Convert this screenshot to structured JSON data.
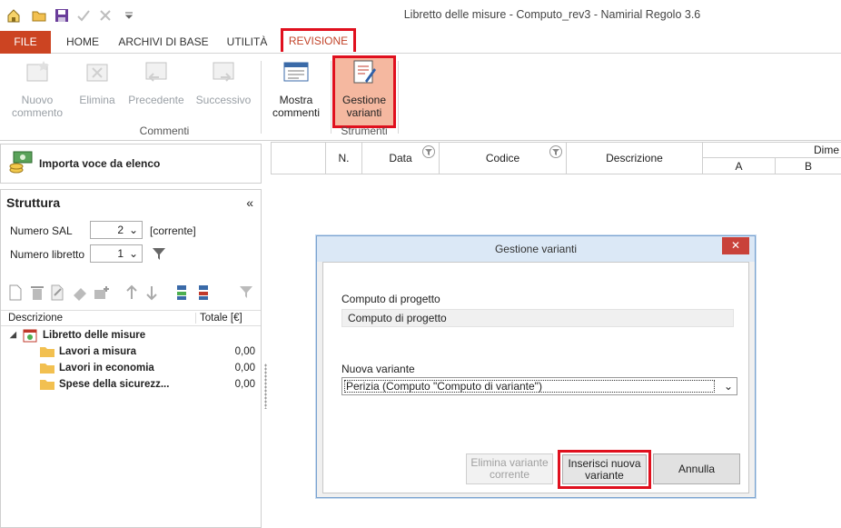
{
  "window": {
    "title": "Libretto delle misure - Computo_rev3 - Namirial Regolo 3.6"
  },
  "menu": {
    "tabs": [
      {
        "label": "FILE"
      },
      {
        "label": "HOME"
      },
      {
        "label": "ARCHIVI DI BASE"
      },
      {
        "label": "UTILITÀ"
      },
      {
        "label": "REVISIONE"
      }
    ]
  },
  "ribbon": {
    "commenti_group": "Commenti",
    "strumenti_group": "Strumenti",
    "nuovo_1": "Nuovo",
    "nuovo_2": "commento",
    "elimina": "Elimina",
    "precedente": "Precedente",
    "successivo": "Successivo",
    "mostra_1": "Mostra",
    "mostra_2": "commenti",
    "gestione_1": "Gestione",
    "gestione_2": "varianti"
  },
  "left": {
    "import_label": "Importa voce da elenco",
    "struttura_title": "Struttura",
    "collapse_glyph": "«",
    "sal_label": "Numero SAL",
    "sal_value": "2",
    "sal_note": "[corrente]",
    "libretto_label": "Numero libretto",
    "libretto_value": "1",
    "col_descrizione": "Descrizione",
    "col_totale": "Totale [€]",
    "tree": {
      "root": "Libretto delle misure",
      "items": [
        {
          "label": "Lavori a misura",
          "value": "0,00"
        },
        {
          "label": "Lavori in economia",
          "value": "0,00"
        },
        {
          "label": "Spese della sicurezz...",
          "value": "0,00"
        }
      ]
    }
  },
  "grid": {
    "headers": {
      "n": "N.",
      "data": "Data",
      "codice": "Codice",
      "descrizione": "Descrizione",
      "dime": "Dime",
      "a": "A",
      "b": "B"
    }
  },
  "dialog": {
    "title": "Gestione varianti",
    "close_glyph": "✕",
    "computo_label": "Computo di progetto",
    "computo_value": "Computo di progetto",
    "nuova_label": "Nuova variante",
    "nuova_value": "Perizia (Computo \"Computo di variante\")",
    "btn_elimina_1": "Elimina variante",
    "btn_elimina_2": "corrente",
    "btn_inserisci_1": "Inserisci nuova",
    "btn_inserisci_2": "variante",
    "btn_annulla": "Annulla"
  },
  "colors": {
    "file_tab": "#cc4422",
    "highlight": "#e0101e",
    "selected_button": "#f5b8a0"
  }
}
